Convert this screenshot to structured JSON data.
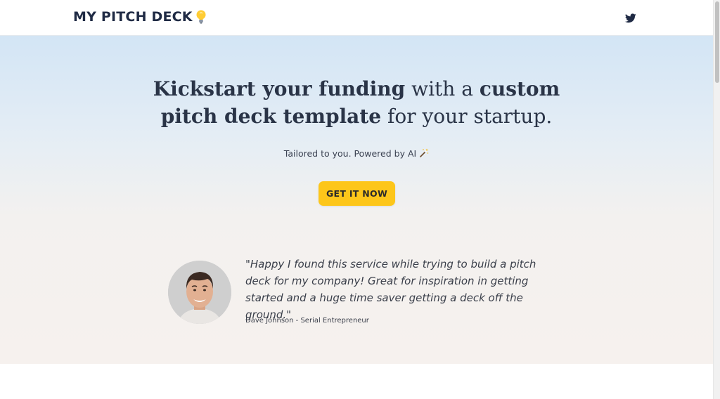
{
  "navbar": {
    "brand": "MY PITCH DECK",
    "brand_icon": "lightbulb-icon",
    "social_icon": "twitter-icon"
  },
  "hero": {
    "headline": {
      "part1": "Kickstart your funding",
      "part2": " with a ",
      "part3": "custom pitch deck template",
      "part4": " for your startup."
    },
    "tagline": "Tailored to you. Powered by AI",
    "tagline_icon": "magic-wand-icon",
    "cta_label": "GET IT NOW"
  },
  "testimonial": {
    "quote": "\"Happy I found this service while trying to build a pitch deck for my company! Great for inspiration in getting started and a huge time saver getting a deck off the ground.\"",
    "author": "Dave Johnson - Serial Entrepreneur"
  },
  "colors": {
    "cta": "#fdc61a",
    "heading": "#2a3447",
    "hero_top": "#d3e5f5",
    "hero_bottom": "#f6f1ee"
  }
}
